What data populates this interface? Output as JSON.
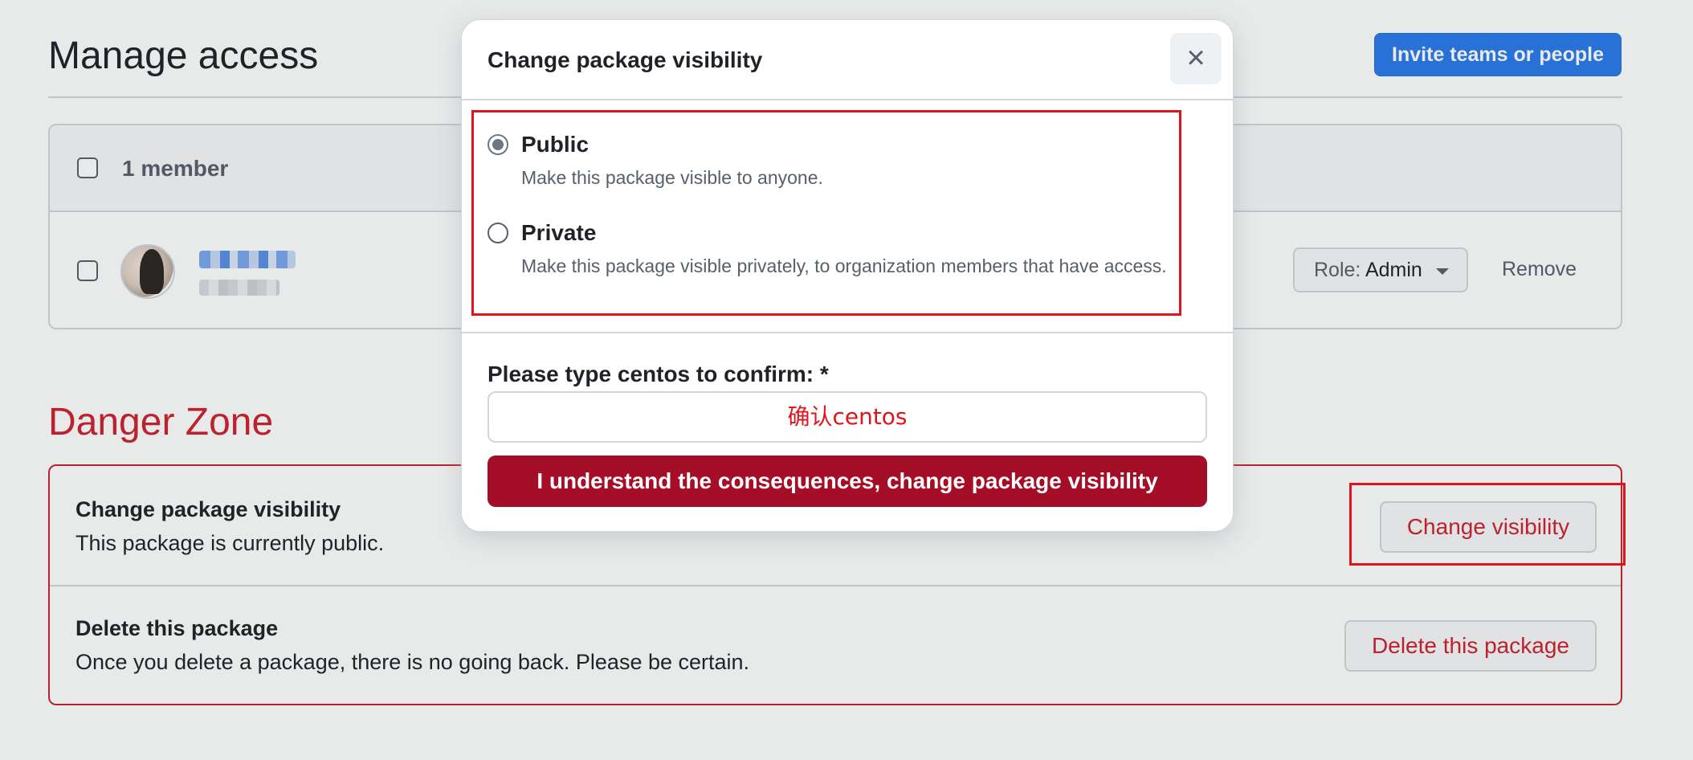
{
  "manage_access": {
    "title": "Manage access",
    "invite_button": "Invite teams or people",
    "member_count": "1 member",
    "member_row": {
      "role_prefix": "Role: ",
      "role_value": "Admin",
      "remove_label": "Remove"
    }
  },
  "danger_zone": {
    "title": "Danger Zone",
    "items": [
      {
        "title": "Change package visibility",
        "description": "This package is currently public.",
        "button": "Change visibility"
      },
      {
        "title": "Delete this package",
        "description": "Once you delete a package, there is no going back. Please be certain.",
        "button": "Delete this package"
      }
    ]
  },
  "modal": {
    "title": "Change package visibility",
    "close_glyph": "×",
    "options": [
      {
        "label": "Public",
        "description": "Make this package visible to anyone.",
        "checked": true
      },
      {
        "label": "Private",
        "description": "Make this package visible privately, to organization members that have access.",
        "checked": false
      }
    ],
    "confirm_label": "Please type centos to confirm: *",
    "confirm_value": "确认centos",
    "confirm_button": "I understand the consequences, change package visibility"
  },
  "colors": {
    "primary_blue": "#2a7aea",
    "danger_red": "#cf222e",
    "confirm_button": "#a40e26",
    "annotation_red": "#e2141b"
  },
  "icons": {
    "close": "close-icon",
    "dropdown": "caret-down-icon"
  }
}
